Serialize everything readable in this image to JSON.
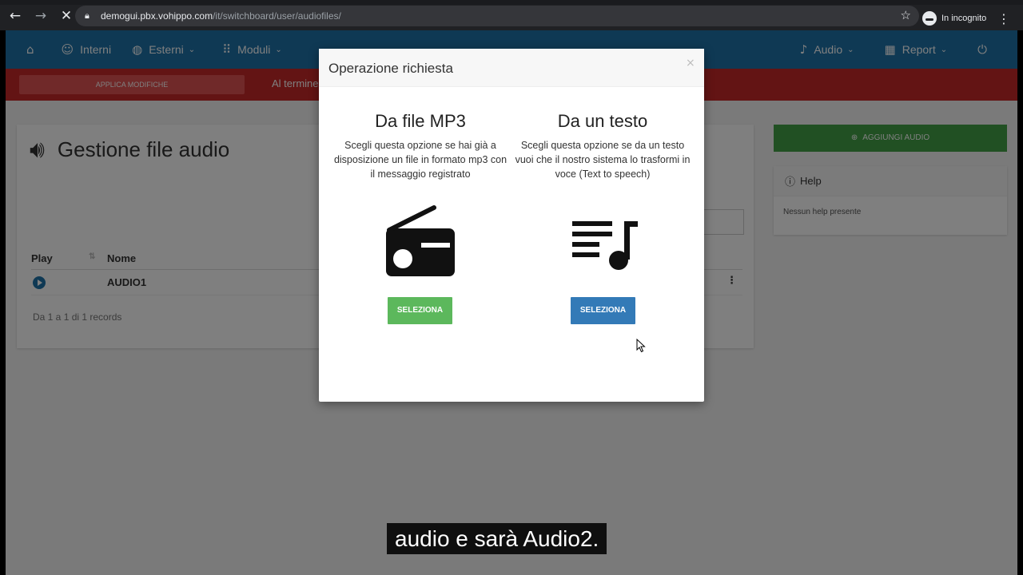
{
  "browser": {
    "url_host": "demogui.pbx.vohippo.com",
    "url_path": "/it/switchboard/user/audiofiles/",
    "incognito_label": "In incognito"
  },
  "nav": {
    "interni": "Interni",
    "esterni": "Esterni",
    "moduli": "Moduli",
    "audio": "Audio",
    "report": "Report"
  },
  "alert": {
    "apply_label": "APPLICA MODIFICHE",
    "text": "Al termine"
  },
  "main": {
    "title": "Gestione file audio",
    "columns": [
      "Play",
      "Nome"
    ],
    "rows": [
      {
        "name": "AUDIO1"
      }
    ],
    "records_text": "Da 1 a 1 di 1 records"
  },
  "sidebar": {
    "add_audio_label": "AGGIUNGI AUDIO",
    "help_title": "Help",
    "help_body": "Nessun help presente"
  },
  "modal": {
    "title": "Operazione richiesta",
    "close_glyph": "×",
    "options": [
      {
        "title": "Da file MP3",
        "description": "Scegli questa opzione se hai già a disposizione un file in formato mp3 con il messaggio registrato",
        "button": "SELEZIONA",
        "icon": "radio-icon",
        "color": "#5cb85c"
      },
      {
        "title": "Da un testo",
        "description": "Scegli questa opzione se da un testo vuoi che il nostro sistema lo trasformi in voce (Text to speech)",
        "button": "SELEZIONA",
        "icon": "playlist-music-icon",
        "color": "#337ab7"
      }
    ]
  },
  "subtitle": "audio e sarà Audio2.",
  "colors": {
    "nav_blue": "#1e73a9",
    "alert_red": "#c62828",
    "add_green": "#43a047"
  }
}
